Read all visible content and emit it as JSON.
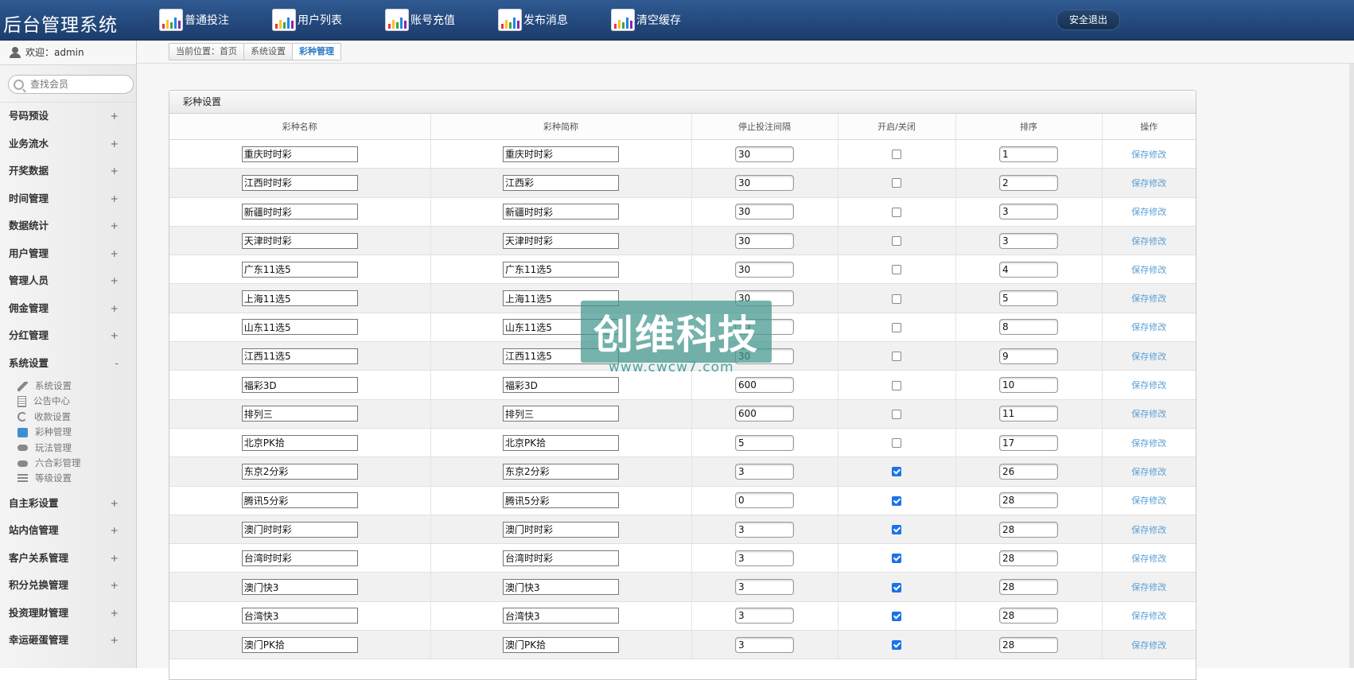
{
  "header": {
    "title": "后台管理系统",
    "nav": [
      {
        "label": "普通投注",
        "icon": "chart-icon"
      },
      {
        "label": "用户列表",
        "icon": "chart-icon"
      },
      {
        "label": "账号充值",
        "icon": "chart-icon"
      },
      {
        "label": "发布消息",
        "icon": "chart-icon"
      },
      {
        "label": "清空缓存",
        "icon": "chart-icon"
      }
    ],
    "logout": "安全退出"
  },
  "sidebar": {
    "welcome": "欢迎：admin",
    "search_placeholder": "查找会员",
    "menu_top": [
      {
        "label": "号码预设",
        "sign": "+"
      },
      {
        "label": "业务流水",
        "sign": "+"
      },
      {
        "label": "开奖数据",
        "sign": "+"
      },
      {
        "label": "时间管理",
        "sign": "+"
      },
      {
        "label": "数据统计",
        "sign": "+"
      },
      {
        "label": "用户管理",
        "sign": "+"
      },
      {
        "label": "管理人员",
        "sign": "+"
      },
      {
        "label": "佣金管理",
        "sign": "+"
      },
      {
        "label": "分红管理",
        "sign": "+"
      }
    ],
    "expanded": {
      "label": "系统设置",
      "sign": "-"
    },
    "submenu": [
      {
        "label": "系统设置",
        "icon": "wrench-icon"
      },
      {
        "label": "公告中心",
        "icon": "document-icon"
      },
      {
        "label": "收款设置",
        "icon": "refresh-icon"
      },
      {
        "label": "彩种管理",
        "icon": "star-box-icon"
      },
      {
        "label": "玩法管理",
        "icon": "gamepad-icon"
      },
      {
        "label": "六合彩管理",
        "icon": "gamepad-icon"
      },
      {
        "label": "等级设置",
        "icon": "layers-icon"
      }
    ],
    "menu_bottom": [
      {
        "label": "自主彩设置",
        "sign": "+"
      },
      {
        "label": "站内信管理",
        "sign": "+"
      },
      {
        "label": "客户关系管理",
        "sign": "+"
      },
      {
        "label": "积分兑换管理",
        "sign": "+"
      },
      {
        "label": "投资理财管理",
        "sign": "+"
      },
      {
        "label": "幸运砸蛋管理",
        "sign": "+"
      }
    ]
  },
  "breadcrumb": [
    "当前位置：首页",
    "系统设置",
    "彩种管理"
  ],
  "panel": {
    "title": "彩种设置",
    "columns": [
      "彩种名称",
      "彩种简称",
      "停止投注间隔",
      "开启/关闭",
      "排序",
      "操作"
    ],
    "action_label": "保存修改",
    "rows": [
      {
        "name": "重庆时时彩",
        "short": "重庆时时彩",
        "interval": "30",
        "enabled": false,
        "sort": "1"
      },
      {
        "name": "江西时时彩",
        "short": "江西彩",
        "interval": "30",
        "enabled": false,
        "sort": "2"
      },
      {
        "name": "新疆时时彩",
        "short": "新疆时时彩",
        "interval": "30",
        "enabled": false,
        "sort": "3"
      },
      {
        "name": "天津时时彩",
        "short": "天津时时彩",
        "interval": "30",
        "enabled": false,
        "sort": "3"
      },
      {
        "name": "广东11选5",
        "short": "广东11选5",
        "interval": "30",
        "enabled": false,
        "sort": "4"
      },
      {
        "name": "上海11选5",
        "short": "上海11选5",
        "interval": "30",
        "enabled": false,
        "sort": "5"
      },
      {
        "name": "山东11选5",
        "short": "山东11选5",
        "interval": "30",
        "enabled": false,
        "sort": "8"
      },
      {
        "name": "江西11选5",
        "short": "江西11选5",
        "interval": "30",
        "enabled": false,
        "sort": "9"
      },
      {
        "name": "福彩3D",
        "short": "福彩3D",
        "interval": "600",
        "enabled": false,
        "sort": "10"
      },
      {
        "name": "排列三",
        "short": "排列三",
        "interval": "600",
        "enabled": false,
        "sort": "11"
      },
      {
        "name": "北京PK拾",
        "short": "北京PK拾",
        "interval": "5",
        "enabled": false,
        "sort": "17"
      },
      {
        "name": "东京2分彩",
        "short": "东京2分彩",
        "interval": "3",
        "enabled": true,
        "sort": "26"
      },
      {
        "name": "腾讯5分彩",
        "short": "腾讯5分彩",
        "interval": "0",
        "enabled": true,
        "sort": "28"
      },
      {
        "name": "澳门时时彩",
        "short": "澳门时时彩",
        "interval": "3",
        "enabled": true,
        "sort": "28"
      },
      {
        "name": "台湾时时彩",
        "short": "台湾时时彩",
        "interval": "3",
        "enabled": true,
        "sort": "28"
      },
      {
        "name": "澳门快3",
        "short": "澳门快3",
        "interval": "3",
        "enabled": true,
        "sort": "28"
      },
      {
        "name": "台湾快3",
        "short": "台湾快3",
        "interval": "3",
        "enabled": true,
        "sort": "28"
      },
      {
        "name": "澳门PK拾",
        "short": "澳门PK拾",
        "interval": "3",
        "enabled": true,
        "sort": "28"
      }
    ]
  },
  "watermark": {
    "text": "创维科技",
    "url": "www.cwcw7.com"
  }
}
